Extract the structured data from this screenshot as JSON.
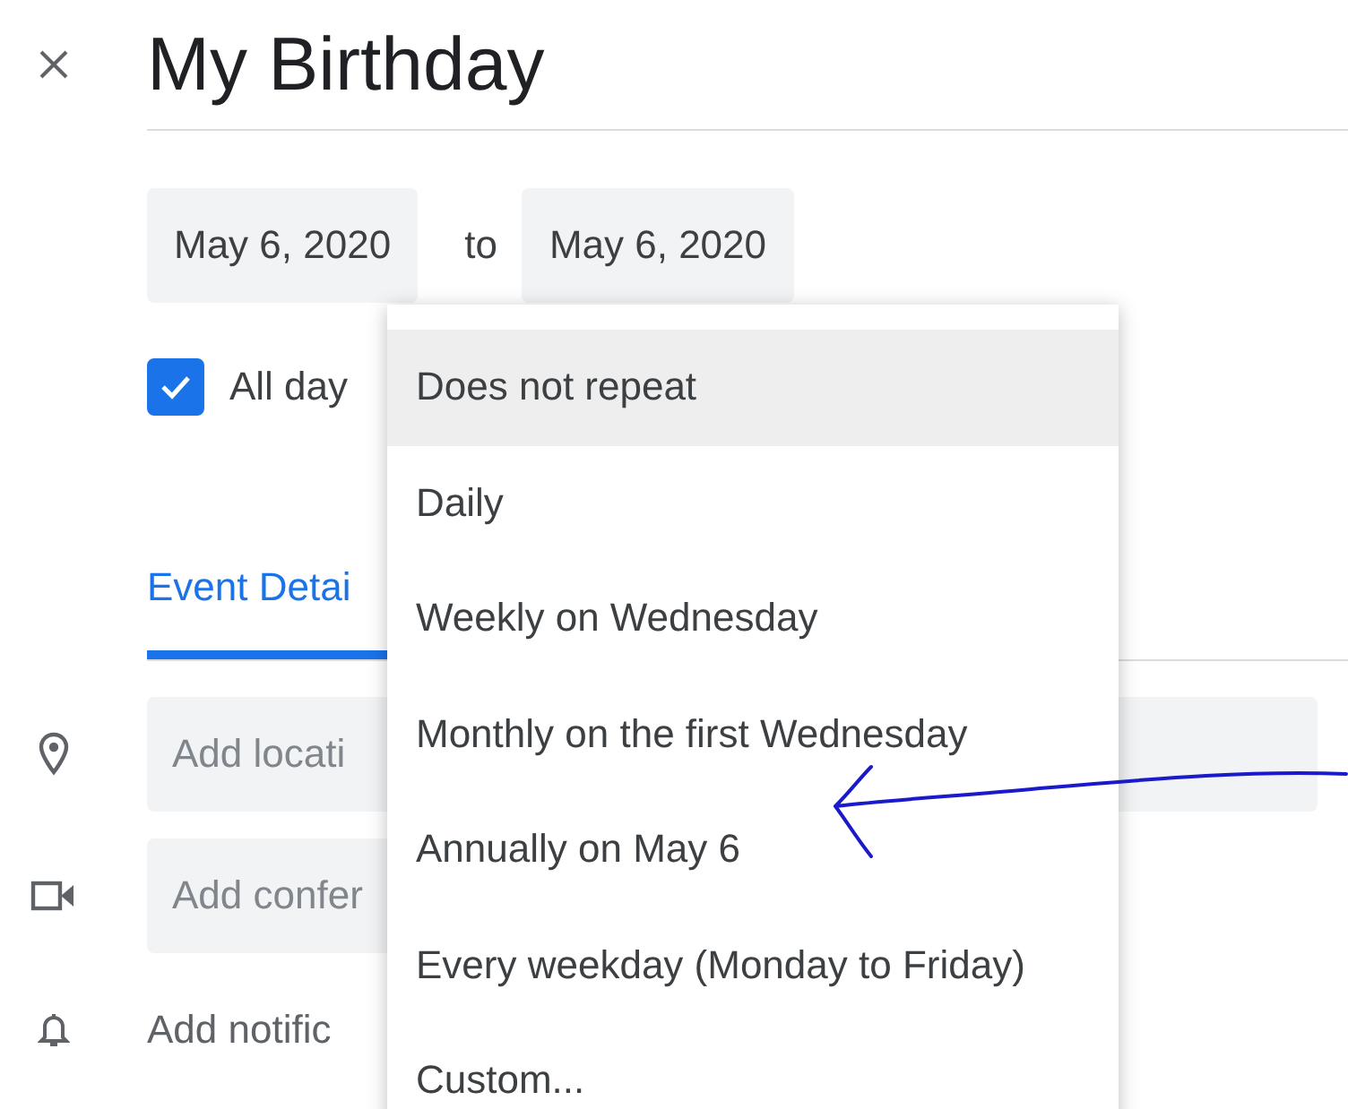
{
  "title": "My Birthday",
  "dates": {
    "start": "May 6, 2020",
    "separator": "to",
    "end": "May 6, 2020"
  },
  "all_day": {
    "label": "All day",
    "checked": true
  },
  "tabs": [
    {
      "label": "Event Detai",
      "selected": true
    }
  ],
  "fields": [
    {
      "kind": "location",
      "placeholder": "Add locati"
    },
    {
      "kind": "conference",
      "placeholder": "Add confer"
    },
    {
      "kind": "notification",
      "placeholder": "Add notific"
    }
  ],
  "repeat_menu": {
    "items": [
      {
        "label": "Does not repeat",
        "selected": true
      },
      {
        "label": "Daily",
        "selected": false
      },
      {
        "label": "Weekly on Wednesday",
        "selected": false
      },
      {
        "label": "Monthly on the first Wednesday",
        "selected": false
      },
      {
        "label": "Annually on May 6",
        "selected": false
      },
      {
        "label": "Every weekday (Monday to Friday)",
        "selected": false
      },
      {
        "label": "Custom...",
        "selected": false
      }
    ]
  }
}
